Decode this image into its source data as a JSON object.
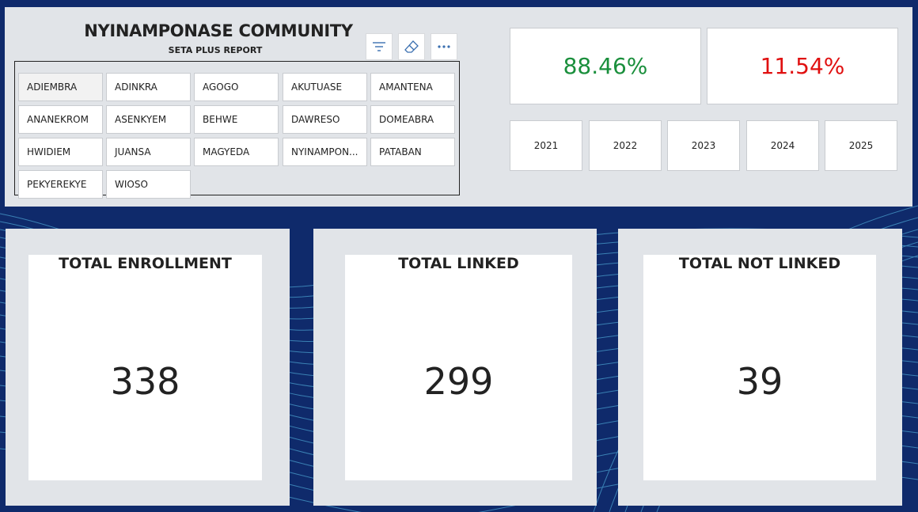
{
  "header": {
    "title": "NYINAMPONASE COMMUNITY",
    "subtitle": "SETA PLUS REPORT"
  },
  "toolbar": {
    "filter_icon": "filter-icon",
    "eraser_icon": "eraser-icon",
    "more_icon": "more-options-icon"
  },
  "communities": [
    "ADIEMBRA",
    "ADINKRA",
    "AGOGO",
    "AKUTUASE",
    "AMANTENA",
    "ANANEKROM",
    "ASENKYEM",
    "BEHWE",
    "DAWRESO",
    "DOMEABRA",
    "HWIDIEM",
    "JUANSA",
    "MAGYEDA",
    "NYINAMPON...",
    "PATABAN",
    "PEKYEREKYE",
    "WIOSO"
  ],
  "percentages": {
    "linked": "88.46%",
    "not_linked": "11.54%",
    "linked_color": "#1a8f3c",
    "not_linked_color": "#e01010"
  },
  "years": [
    "2021",
    "2022",
    "2023",
    "2024",
    "2025"
  ],
  "cards": {
    "enrollment": {
      "label": "TOTAL ENROLLMENT",
      "value": "338"
    },
    "linked": {
      "label": "TOTAL LINKED",
      "value": "299"
    },
    "not_linked": {
      "label": "TOTAL NOT LINKED",
      "value": "39"
    }
  },
  "colors": {
    "background": "#0f2a6b",
    "panel": "#e1e4e8",
    "wave": "#5ec8f0"
  }
}
